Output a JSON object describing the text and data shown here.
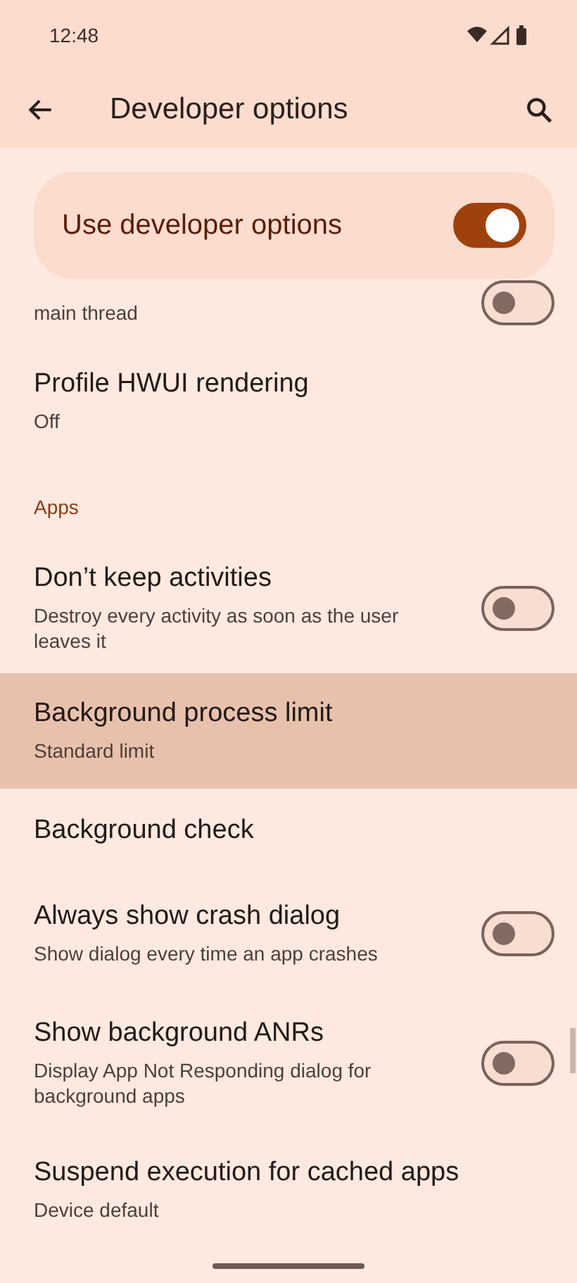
{
  "status_bar": {
    "time": "12:48"
  },
  "toolbar": {
    "title": "Developer options"
  },
  "master_switch": {
    "label": "Use developer options",
    "on": true
  },
  "items": [
    {
      "kind": "toggle",
      "subtitle": "main thread",
      "on": false,
      "selected": false
    },
    {
      "kind": "option",
      "title": "Profile HWUI rendering",
      "subtitle": "Off",
      "selected": false
    },
    {
      "kind": "header",
      "title": "Apps"
    },
    {
      "kind": "toggle",
      "title": "Don’t keep activities",
      "subtitle": "Destroy every activity as soon as the user leaves it",
      "on": false,
      "selected": false
    },
    {
      "kind": "option",
      "title": "Background process limit",
      "subtitle": "Standard limit",
      "selected": true
    },
    {
      "kind": "option",
      "title": "Background check",
      "selected": false
    },
    {
      "kind": "toggle",
      "title": "Always show crash dialog",
      "subtitle": "Show dialog every time an app crashes",
      "on": false,
      "selected": false
    },
    {
      "kind": "toggle",
      "title": "Show background ANRs",
      "subtitle": "Display App Not Responding dialog for background apps",
      "on": false,
      "selected": false
    },
    {
      "kind": "option",
      "title": "Suspend execution for cached apps",
      "subtitle": "Device default",
      "selected": false
    }
  ]
}
